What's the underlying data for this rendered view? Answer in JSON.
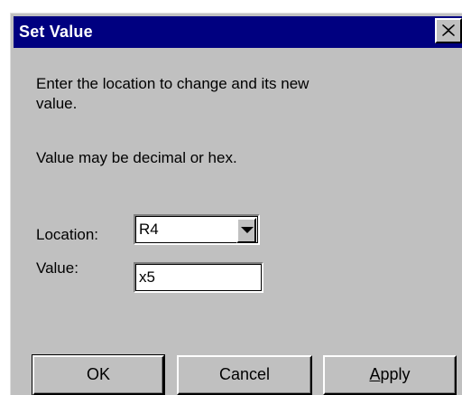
{
  "dialog": {
    "title": "Set Value",
    "close_glyph": "✕",
    "instruction": "Enter the location to change and its new",
    "instruction_line2": "value.",
    "note": "Value may be decimal or hex."
  },
  "form": {
    "location_label": "Location:",
    "location_value": "R4",
    "value_label": "Value:",
    "value_value": "x5"
  },
  "buttons": {
    "ok_label": "OK",
    "cancel_label": "Cancel",
    "apply_accel": "A",
    "apply_rest": "pply"
  },
  "colors": {
    "titlebar": "#000080",
    "face": "#c0c0c0"
  },
  "icons": {
    "close": "close-icon",
    "dropdown": "chevron-down-icon"
  }
}
